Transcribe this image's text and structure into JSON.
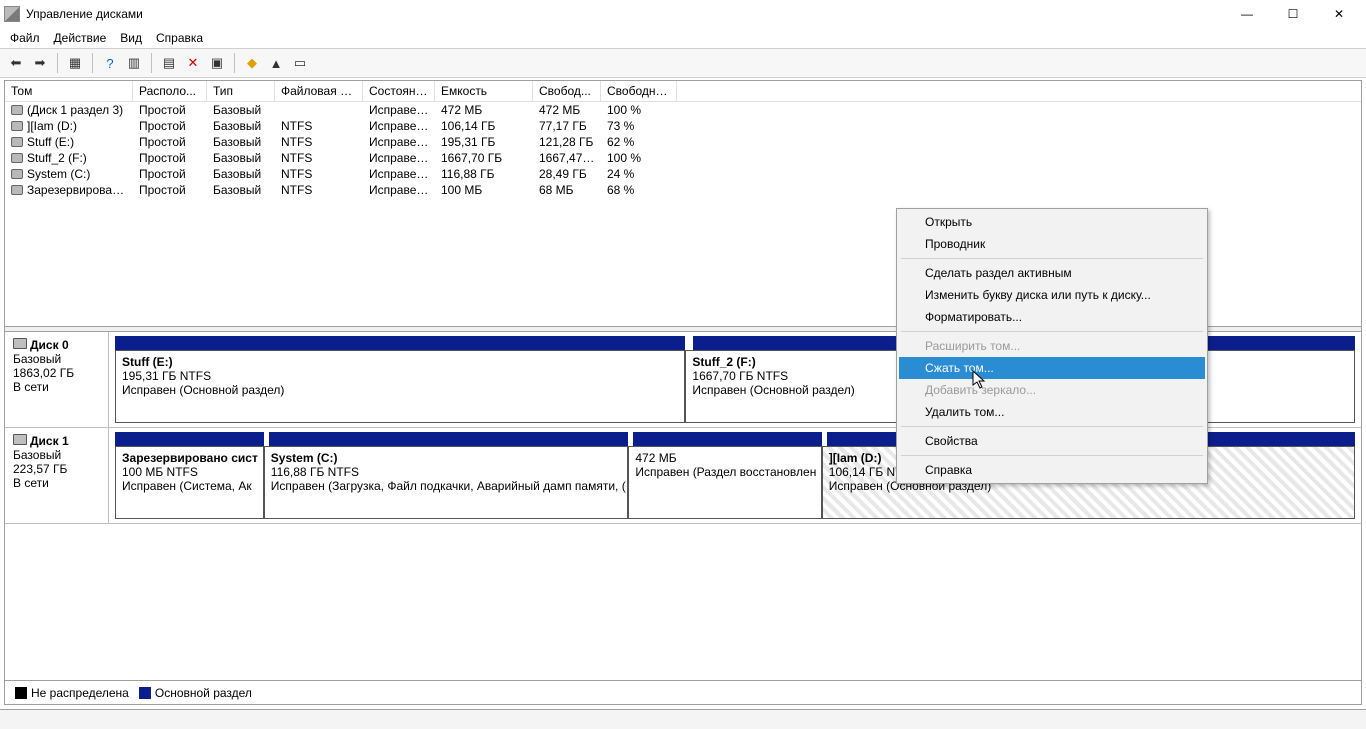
{
  "window": {
    "title": "Управление дисками"
  },
  "menu": {
    "file": "Файл",
    "action": "Действие",
    "view": "Вид",
    "help": "Справка"
  },
  "columns": {
    "volume": "Том",
    "layout": "Располо...",
    "type": "Тип",
    "fs": "Файловая с...",
    "status": "Состояние",
    "capacity": "Емкость",
    "free": "Свобод...",
    "pct": "Свободно %"
  },
  "volumes": [
    {
      "name": "(Диск 1 раздел 3)",
      "layout": "Простой",
      "type": "Базовый",
      "fs": "",
      "status": "Исправен...",
      "cap": "472 МБ",
      "free": "472 МБ",
      "pct": "100 %"
    },
    {
      "name": "][Iam (D:)",
      "layout": "Простой",
      "type": "Базовый",
      "fs": "NTFS",
      "status": "Исправен...",
      "cap": "106,14 ГБ",
      "free": "77,17 ГБ",
      "pct": "73 %"
    },
    {
      "name": "Stuff (E:)",
      "layout": "Простой",
      "type": "Базовый",
      "fs": "NTFS",
      "status": "Исправен...",
      "cap": "195,31 ГБ",
      "free": "121,28 ГБ",
      "pct": "62 %"
    },
    {
      "name": "Stuff_2 (F:)",
      "layout": "Простой",
      "type": "Базовый",
      "fs": "NTFS",
      "status": "Исправен...",
      "cap": "1667,70 ГБ",
      "free": "1667,47 ...",
      "pct": "100 %"
    },
    {
      "name": "System (C:)",
      "layout": "Простой",
      "type": "Базовый",
      "fs": "NTFS",
      "status": "Исправен...",
      "cap": "116,88 ГБ",
      "free": "28,49 ГБ",
      "pct": "24 %"
    },
    {
      "name": "Зарезервировано...",
      "layout": "Простой",
      "type": "Базовый",
      "fs": "NTFS",
      "status": "Исправен...",
      "cap": "100 МБ",
      "free": "68 МБ",
      "pct": "68 %"
    }
  ],
  "disks": [
    {
      "name": "Диск 0",
      "type": "Базовый",
      "size": "1863,02 ГБ",
      "status": "В сети"
    },
    {
      "name": "Диск 1",
      "type": "Базовый",
      "size": "223,57 ГБ",
      "status": "В сети"
    }
  ],
  "disk0": {
    "p0": {
      "name": "Stuff  (E:)",
      "size": "195,31 ГБ NTFS",
      "status": "Исправен (Основной раздел)"
    },
    "p1": {
      "name": "Stuff_2  (F:)",
      "size": "1667,70 ГБ NTFS",
      "status": "Исправен (Основной раздел)"
    }
  },
  "disk1": {
    "p0": {
      "name": "Зарезервировано сист",
      "size": "100 МБ NTFS",
      "status": "Исправен (Система, Ак"
    },
    "p1": {
      "name": "System  (C:)",
      "size": "116,88 ГБ NTFS",
      "status": "Исправен (Загрузка, Файл подкачки, Аварийный дамп памяти, ("
    },
    "p2": {
      "name": "",
      "size": "472 МБ",
      "status": "Исправен (Раздел восстановлен"
    },
    "p3": {
      "name": "][Iam  (D:)",
      "size": "106,14 ГБ NTFS",
      "status": "Исправен (Основной раздел)"
    }
  },
  "legend": {
    "unalloc": "Не распределена",
    "primary": "Основной раздел"
  },
  "context": {
    "open": "Открыть",
    "explorer": "Проводник",
    "active": "Сделать раздел активным",
    "letter": "Изменить букву диска или путь к диску...",
    "format": "Форматировать...",
    "extend": "Расширить том...",
    "shrink": "Сжать том...",
    "mirror": "Добавить зеркало...",
    "delete": "Удалить том...",
    "props": "Свойства",
    "help": "Справка"
  }
}
